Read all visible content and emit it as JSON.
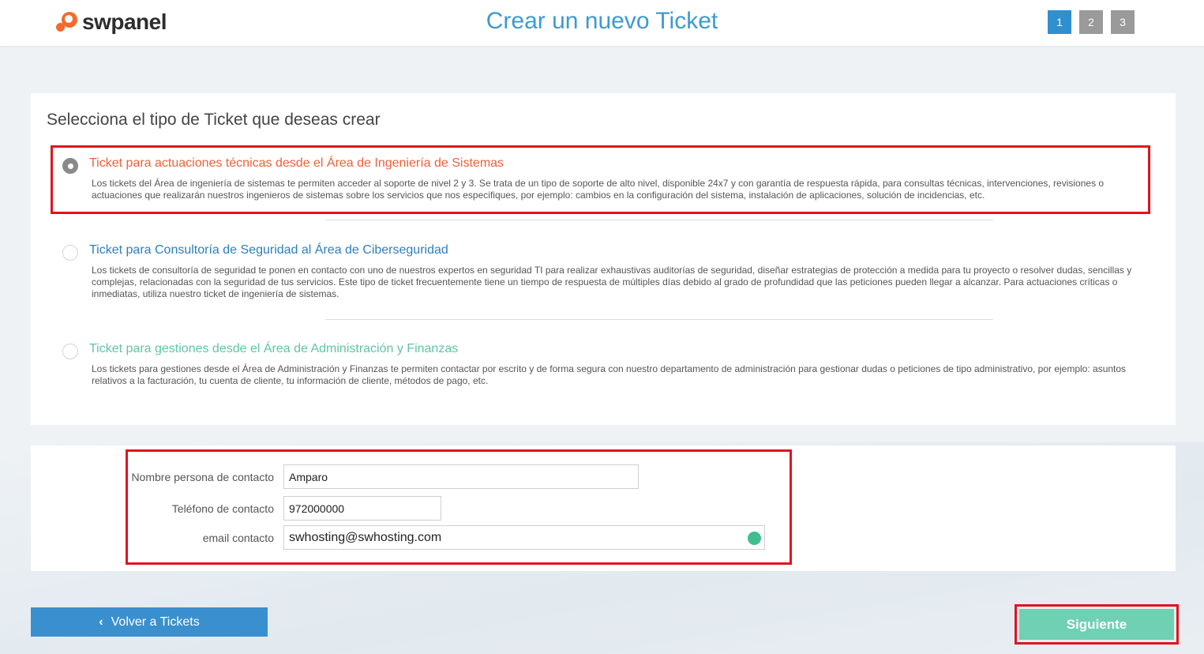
{
  "header": {
    "logo_text": "swpanel",
    "title": "Crear un nuevo Ticket",
    "steps": [
      "1",
      "2",
      "3"
    ],
    "active_step": 1
  },
  "ticket_types": {
    "heading": "Selecciona el tipo de Ticket que deseas crear",
    "options": [
      {
        "title": "Ticket para actuaciones técnicas desde el Área de Ingeniería de Sistemas",
        "description": "Los tickets del Área de ingeniería de sistemas te permiten acceder al soporte de nivel 2 y 3. Se trata de un tipo de soporte de alto nivel, disponible 24x7 y con garantía de respuesta rápida, para consultas técnicas, intervenciones, revisiones o actuaciones que realizarán nuestros ingenieros de sistemas sobre los servicios que nos especifiques, por ejemplo: cambios en la configuración del sistema, instalación de aplicaciones, solución de incidencias, etc.",
        "selected": true,
        "color": "#f0603b"
      },
      {
        "title": "Ticket para Consultoría de Seguridad al Área de Ciberseguridad",
        "description": "Los tickets de consultoría de seguridad te ponen en contacto con uno de nuestros expertos en seguridad TI para realizar exhaustivas auditorías de seguridad, diseñar estrategias de protección a medida para tu proyecto o resolver dudas, sencillas y complejas, relacionadas con la seguridad de tus servicios. Este tipo de ticket frecuentemente tiene un tiempo de respuesta de múltiples días debido al grado de profundidad que las peticiones pueden llegar a alcanzar. Para actuaciones críticas o inmediatas, utiliza nuestro ticket de ingeniería de sistemas.",
        "selected": false,
        "color": "#2a7fc0"
      },
      {
        "title": "Ticket para gestiones desde el Área de Administración y Finanzas",
        "description": "Los tickets para gestiones desde el Área de Administración y Finanzas te permiten contactar por escrito y de forma segura con nuestro departamento de administración para gestionar dudas o peticiones de tipo administrativo, por ejemplo: asuntos relativos a la facturación, tu cuenta de cliente, tu información de cliente, métodos de pago, etc.",
        "selected": false,
        "color": "#5fc6a5"
      }
    ]
  },
  "contact": {
    "name_label": "Nombre persona de contacto",
    "name_value": "Amparo",
    "phone_label": "Teléfono de contacto",
    "phone_value": "972000000",
    "email_label": "email contacto",
    "email_value": "swhosting@swhosting.com",
    "email_status": "check-ok-icon"
  },
  "footer": {
    "back_label": "Volver a Tickets",
    "next_label": "Siguiente"
  },
  "colors": {
    "accent_blue": "#3d9ad1",
    "next_green": "#6fd0b2",
    "highlight_red": "#e0141e"
  }
}
